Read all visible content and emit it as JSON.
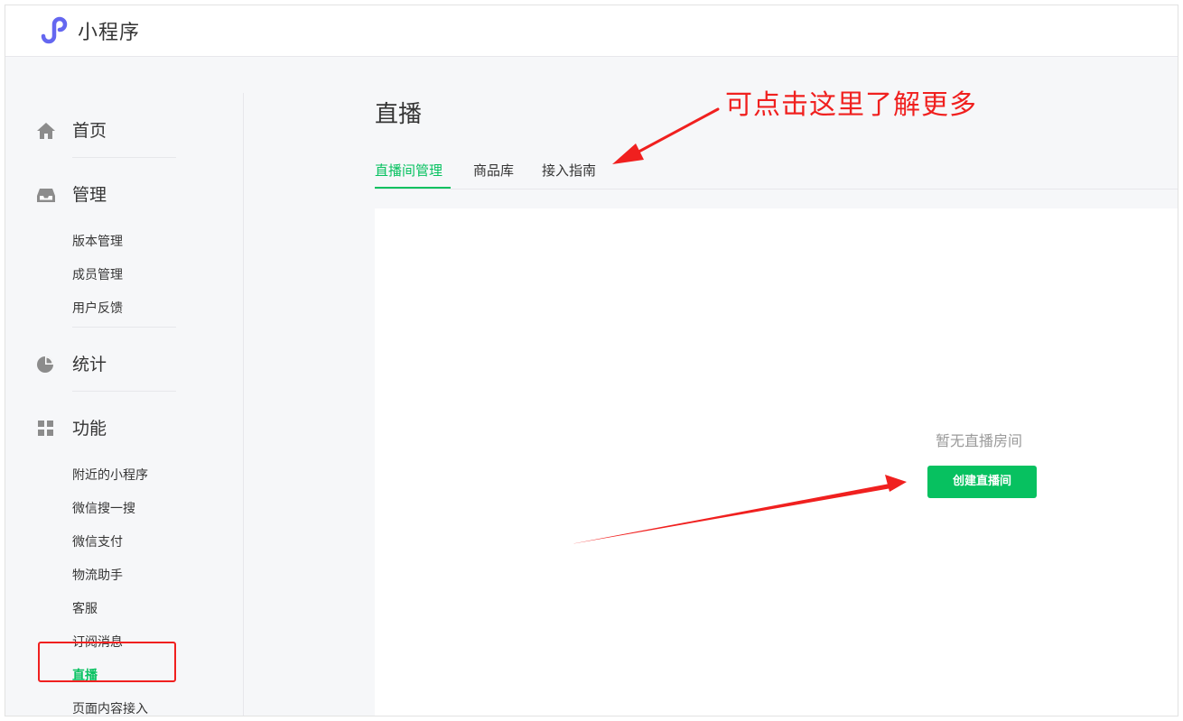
{
  "app": {
    "title": "小程序"
  },
  "sidebar": {
    "groups": [
      {
        "label": "首页",
        "icon": "home-icon"
      },
      {
        "label": "管理",
        "icon": "inbox-icon",
        "items": [
          "版本管理",
          "成员管理",
          "用户反馈"
        ]
      },
      {
        "label": "统计",
        "icon": "pie-chart-icon"
      },
      {
        "label": "功能",
        "icon": "grid-icon",
        "items": [
          "附近的小程序",
          "微信搜一搜",
          "微信支付",
          "物流助手",
          "客服",
          "订阅消息",
          "直播",
          "页面内容接入"
        ]
      }
    ],
    "active_item": "直播"
  },
  "main": {
    "title": "直播",
    "tabs": [
      {
        "label": "直播间管理",
        "active": true
      },
      {
        "label": "商品库",
        "active": false
      },
      {
        "label": "接入指南",
        "active": false
      }
    ],
    "empty_text": "暂无直播房间",
    "create_button": "创建直播间"
  },
  "annotation": {
    "text": "可点击这里了解更多"
  },
  "colors": {
    "accent": "#07c160",
    "annotation": "#f0201f",
    "text": "#353535",
    "muted": "#9a9a9a",
    "logo": "#6467f0"
  }
}
